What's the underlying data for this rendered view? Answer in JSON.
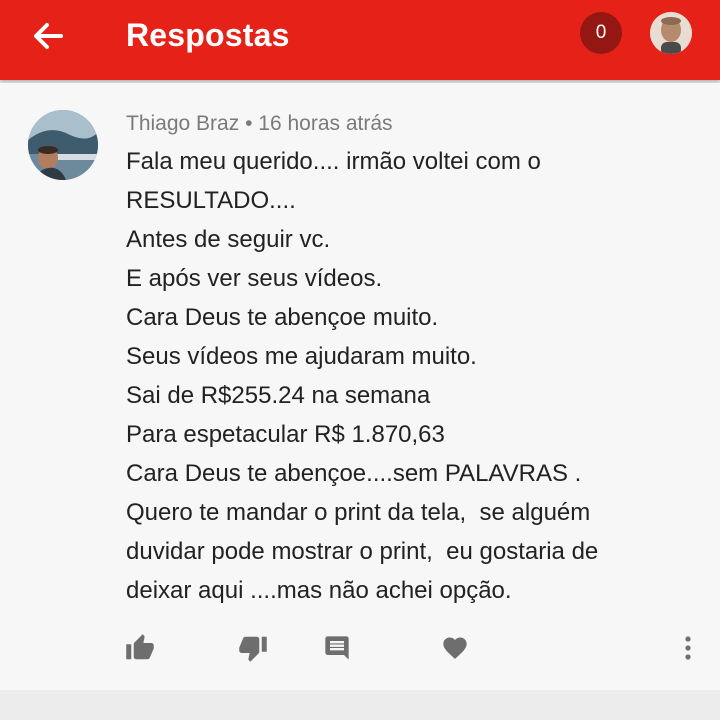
{
  "appbar": {
    "title": "Respostas",
    "notification_count": "0",
    "back_icon": "arrow-back-icon",
    "account_icon": "account-avatar"
  },
  "comment": {
    "author": "Thiago Braz",
    "separator": "•",
    "time": "16 horas atrás",
    "lines": [
      "Fala meu querido.... irmão voltei com o",
      "RESULTADO....",
      "Antes de seguir vc.",
      "E após ver seus vídeos.",
      "Cara Deus te abençoe muito.",
      "Seus vídeos me ajudaram muito.",
      "Sai de R$255.24 na semana",
      "Para espetacular R$ 1.870,63",
      "Cara Deus te abençoe....sem PALAVRAS .",
      "Quero te mandar o print da tela,  se alguém",
      "duvidar pode mostrar o print,  eu gostaria de",
      "deixar aqui ....mas não achei opção."
    ]
  },
  "actions": {
    "icons": [
      "thumb-up-icon",
      "thumb-down-icon",
      "reply-comment-icon",
      "heart-icon",
      "more-vert-icon"
    ]
  },
  "colors": {
    "brand_red": "#e62117",
    "badge_dark_red": "#951713",
    "icon_gray": "#6e6e6e"
  }
}
